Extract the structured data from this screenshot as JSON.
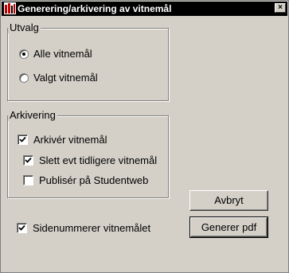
{
  "window": {
    "title": "Generering/arkivering av vitnemål",
    "close_glyph": "×"
  },
  "utvalg": {
    "label": "Utvalg",
    "options": [
      {
        "label": "Alle vitnemål",
        "selected": true
      },
      {
        "label": "Valgt vitnemål",
        "selected": false
      }
    ]
  },
  "arkivering": {
    "label": "Arkivering",
    "arkiver": {
      "label": "Arkivér vitnemål",
      "checked": true
    },
    "slett": {
      "label": "Slett evt tidligere vitnemål",
      "checked": true
    },
    "publiser": {
      "label": "Publisér på Studentweb",
      "checked": false
    }
  },
  "sidenummerer": {
    "label": "Sidenummerer vitnemålet",
    "checked": true
  },
  "buttons": {
    "cancel": "Avbryt",
    "generate": "Generer pdf"
  },
  "icons": {
    "app": "app-icon",
    "close": "close-icon"
  }
}
